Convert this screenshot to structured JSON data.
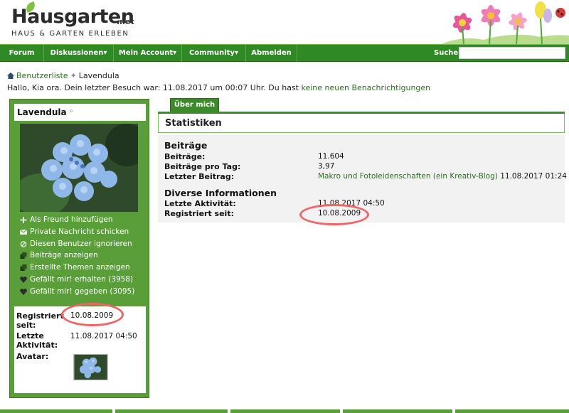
{
  "logo": {
    "main": "Hausgarten",
    "suffix": ".net",
    "tagline": "HAUS & GARTEN ERLEBEN"
  },
  "nav": {
    "items": [
      "Forum",
      "Diskussionen",
      "Mein Account",
      "Community",
      "Abmelden"
    ],
    "search_label": "Suchen",
    "search_placeholder": ""
  },
  "breadcrumb": {
    "root": "Benutzerliste",
    "current": "Lavendula"
  },
  "greeting": {
    "prefix": "Hallo, Kia ora. Dein letzter Besuch war: 11.08.2017 um 00:07 Uhr. Du hast ",
    "link": "keine neuen Benachrichtigungen"
  },
  "profile": {
    "name": "Lavendula",
    "status_glyph": "°",
    "actions": [
      {
        "label": "Als Freund hinzufügen",
        "icon": "plus-icon"
      },
      {
        "label": "Private Nachricht schicken",
        "icon": "envelope-icon"
      },
      {
        "label": "Diesen Benutzer ignorieren",
        "icon": "block-icon"
      },
      {
        "label": "Beiträge anzeigen",
        "icon": "posts-icon"
      },
      {
        "label": "Erstellte Themen anzeigen",
        "icon": "threads-icon"
      },
      {
        "label": "Gefällt mir! erhalten (3958)",
        "icon": "like-received-icon"
      },
      {
        "label": "Gefällt mir! gegeben (3095)",
        "icon": "like-given-icon"
      }
    ],
    "info": {
      "registered_label": "Registriert seit:",
      "registered_value": "10.08.2009",
      "last_activity_label": "Letzte Aktivität:",
      "last_activity_value": "11.08.2017 04:50",
      "avatar_label": "Avatar:"
    }
  },
  "main": {
    "tab": "Über mich",
    "stats_title": "Statistiken",
    "posts_section": "Beiträge",
    "rows_posts": [
      {
        "label": "Beiträge:",
        "value": "11.604"
      },
      {
        "label": "Beiträge pro Tag:",
        "value": "3,97"
      }
    ],
    "last_post_label": "Letzter Beitrag:",
    "last_post_link": "Makro und Fotoleidenschaften (ein Kreativ-Blog)",
    "last_post_date": "11.08.2017 01:24",
    "misc_section": "Diverse Informationen",
    "rows_misc": [
      {
        "label": "Letzte Aktivität:",
        "value": "11.08.2017 04:50"
      },
      {
        "label": "Registriert seit:",
        "value": "10.08.2009"
      }
    ]
  },
  "colors": {
    "nav_green": "#2f8a25",
    "sidebar_green": "#5a9e3a",
    "link_green": "#2a6e1f",
    "highlight": "#f06565"
  }
}
